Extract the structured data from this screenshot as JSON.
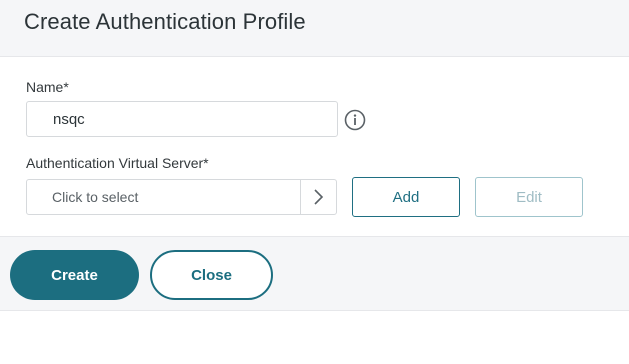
{
  "dialog": {
    "title": "Create Authentication Profile"
  },
  "form": {
    "name_label": "Name*",
    "name_value": "nsqc",
    "info_icon": "info-circle-icon",
    "vserver_label": "Authentication Virtual Server*",
    "vserver_placeholder": "Click to select",
    "vserver_chevron_icon": "chevron-right-icon",
    "add_label": "Add",
    "edit_label": "Edit"
  },
  "footer": {
    "create_label": "Create",
    "close_label": "Close"
  },
  "colors": {
    "accent": "#1c6e80",
    "disabled_accent": "#9fc4cc",
    "header_bg": "#f5f6f8",
    "text": "#2c3438"
  }
}
